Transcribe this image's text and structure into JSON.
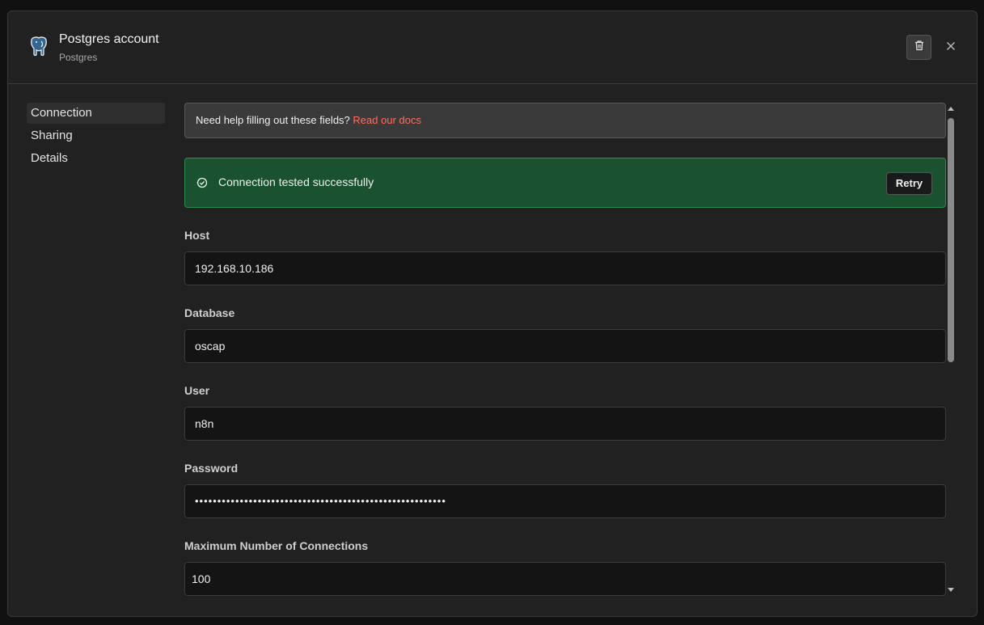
{
  "header": {
    "title": "Postgres account",
    "subtitle": "Postgres"
  },
  "sidebar": {
    "items": [
      {
        "label": "Connection"
      },
      {
        "label": "Sharing"
      },
      {
        "label": "Details"
      }
    ]
  },
  "help": {
    "text": "Need help filling out these fields?",
    "link": "Read our docs"
  },
  "status": {
    "text": "Connection tested successfully",
    "retry_label": "Retry"
  },
  "fields": {
    "host": {
      "label": "Host",
      "value": "192.168.10.186"
    },
    "database": {
      "label": "Database",
      "value": "oscap"
    },
    "user": {
      "label": "User",
      "value": "n8n"
    },
    "password": {
      "label": "Password",
      "value": "••••••••••••••••••••••••••••••••••••••••••••••••••••••••"
    },
    "max_connections": {
      "label": "Maximum Number of Connections",
      "value": "100"
    }
  },
  "icons": {
    "app": "postgres-elephant-icon",
    "delete": "trash-icon",
    "close": "close-icon",
    "status": "check-circle-icon"
  },
  "colors": {
    "accent_link": "#ff6e5e",
    "success_bg": "#1a5230",
    "success_border": "#2e8a50"
  }
}
